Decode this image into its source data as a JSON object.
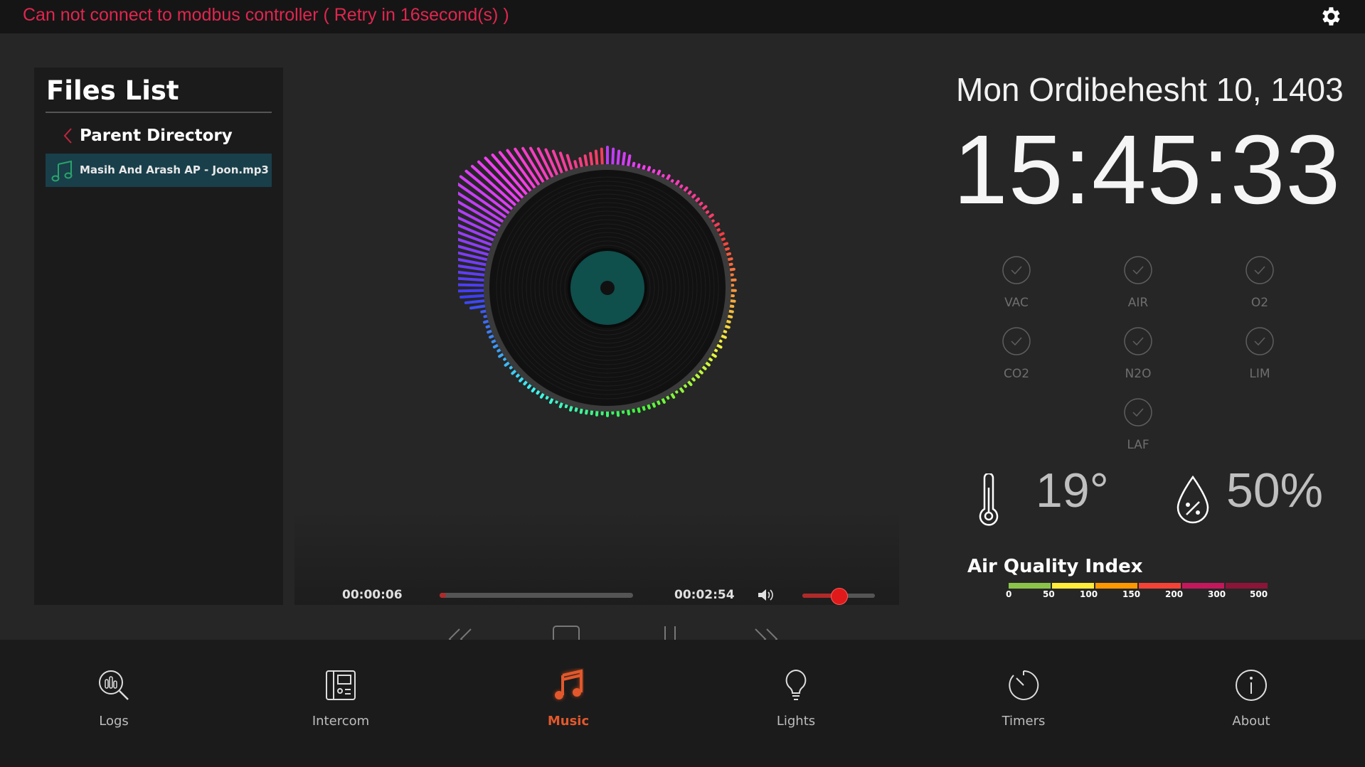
{
  "status": {
    "error_message": "Can not connect to modbus controller ( Retry in 16second(s) )"
  },
  "files": {
    "title": "Files List",
    "parent_label": "Parent Directory",
    "items": [
      "Masih And Arash AP - Joon.mp3"
    ]
  },
  "player": {
    "elapsed": "00:00:06",
    "duration": "00:02:54",
    "progress_fraction": 0.034,
    "volume_fraction": 0.5
  },
  "datetime": {
    "date": "Mon Ordibehesht 10, 1403",
    "time": "15:45:33"
  },
  "gases": [
    {
      "label": "VAC"
    },
    {
      "label": "AIR"
    },
    {
      "label": "O2"
    },
    {
      "label": "CO2"
    },
    {
      "label": "N2O"
    },
    {
      "label": "LIM"
    },
    {
      "label": "LAF"
    }
  ],
  "environment": {
    "temperature": "19°",
    "humidity": "50%"
  },
  "aqi": {
    "title": "Air Quality Index",
    "ticks": [
      "0",
      "50",
      "100",
      "150",
      "200",
      "300",
      "500"
    ],
    "colors": [
      "#8bc34a",
      "#ffeb3b",
      "#ff9800",
      "#f44336",
      "#c2185b",
      "#8b1538"
    ]
  },
  "nav": [
    {
      "label": "Logs",
      "icon": "logs-search-icon"
    },
    {
      "label": "Intercom",
      "icon": "intercom-icon"
    },
    {
      "label": "Music",
      "icon": "music-note-icon",
      "active": true
    },
    {
      "label": "Lights",
      "icon": "lightbulb-icon"
    },
    {
      "label": "Timers",
      "icon": "timer-icon"
    },
    {
      "label": "About",
      "icon": "info-icon"
    }
  ],
  "colors": {
    "accent": "#e2582c",
    "error": "#e0264f",
    "selected_file_bg": "#193f4a"
  }
}
